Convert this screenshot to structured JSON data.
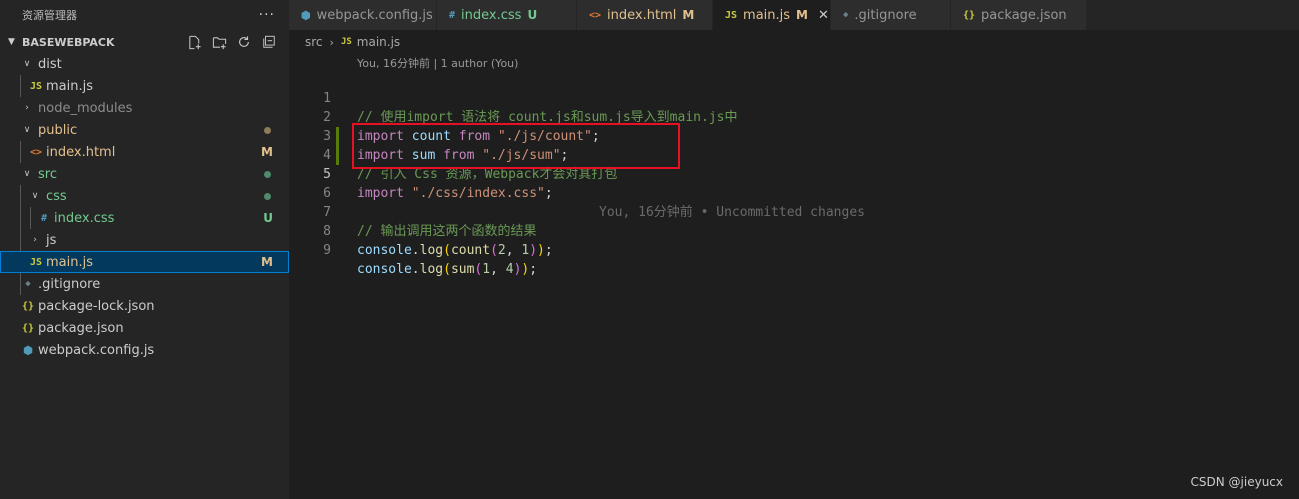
{
  "explorer": {
    "title": "资源管理器",
    "more": "···",
    "project": "BASEWEBPACK"
  },
  "tree": {
    "dist": "dist",
    "dist_main": "main.js",
    "node_modules": "node_modules",
    "public": "public",
    "public_index": "index.html",
    "public_index_badge": "M",
    "src": "src",
    "css": "css",
    "index_css": "index.css",
    "index_css_badge": "U",
    "js": "js",
    "main_js": "main.js",
    "main_js_badge": "M",
    "gitignore": ".gitignore",
    "package_lock": "package-lock.json",
    "package_json": "package.json",
    "webpack_config": "webpack.config.js"
  },
  "icons": {
    "js": "JS",
    "css": "#",
    "html": "<>",
    "json": "{}",
    "gitignore": "◆",
    "webpack": "⬢"
  },
  "colors": {
    "js": "#cbcb41",
    "css": "#519aba",
    "html": "#e37933",
    "json": "#cbcb41",
    "modified": "#e2c08d",
    "untracked": "#73c991",
    "dot_public": "#8c7c5a",
    "dot_src": "#4f8a6b"
  },
  "tabs": [
    {
      "label": "webpack.config.js",
      "badge": ""
    },
    {
      "label": "index.css",
      "badge": "U"
    },
    {
      "label": "index.html",
      "badge": "M"
    },
    {
      "label": "main.js",
      "badge": "M"
    },
    {
      "label": ".gitignore",
      "badge": ""
    },
    {
      "label": "package.json",
      "badge": ""
    }
  ],
  "tab_close": "✕",
  "breadcrumb": {
    "folder": "src",
    "file": "main.js"
  },
  "editor": {
    "codelens": "You, 16分钟前 | 1 author (You)",
    "blame": "You, 16分钟前 • Uncommitted changes",
    "line_numbers": [
      "1",
      "2",
      "3",
      "4",
      "5",
      "6",
      "7",
      "8",
      "9"
    ],
    "l1": "// 使用import 语法将 count.js和sum.js导入到main.js中",
    "l2_kw": "import",
    "l2_var": "count",
    "l2_from": "from",
    "l2_str": "\"./js/count\"",
    "l3_kw": "import",
    "l3_var": "sum",
    "l3_from": "from",
    "l3_str": "\"./js/sum\"",
    "l4": "// 引入 Css 资源，Webpack才会对其打包",
    "l5_kw": "import",
    "l5_str": "\"./css/index.css\"",
    "l7": "// 输出调用这两个函数的结果",
    "l8_obj": "console",
    "l8_fn": "log",
    "l8_inner": "count",
    "l8_a": "2",
    "l8_b": "1",
    "l9_obj": "console",
    "l9_fn": "log",
    "l9_inner": "sum",
    "l9_a": "1",
    "l9_b": "4"
  },
  "watermark": "CSDN @jieyucx"
}
